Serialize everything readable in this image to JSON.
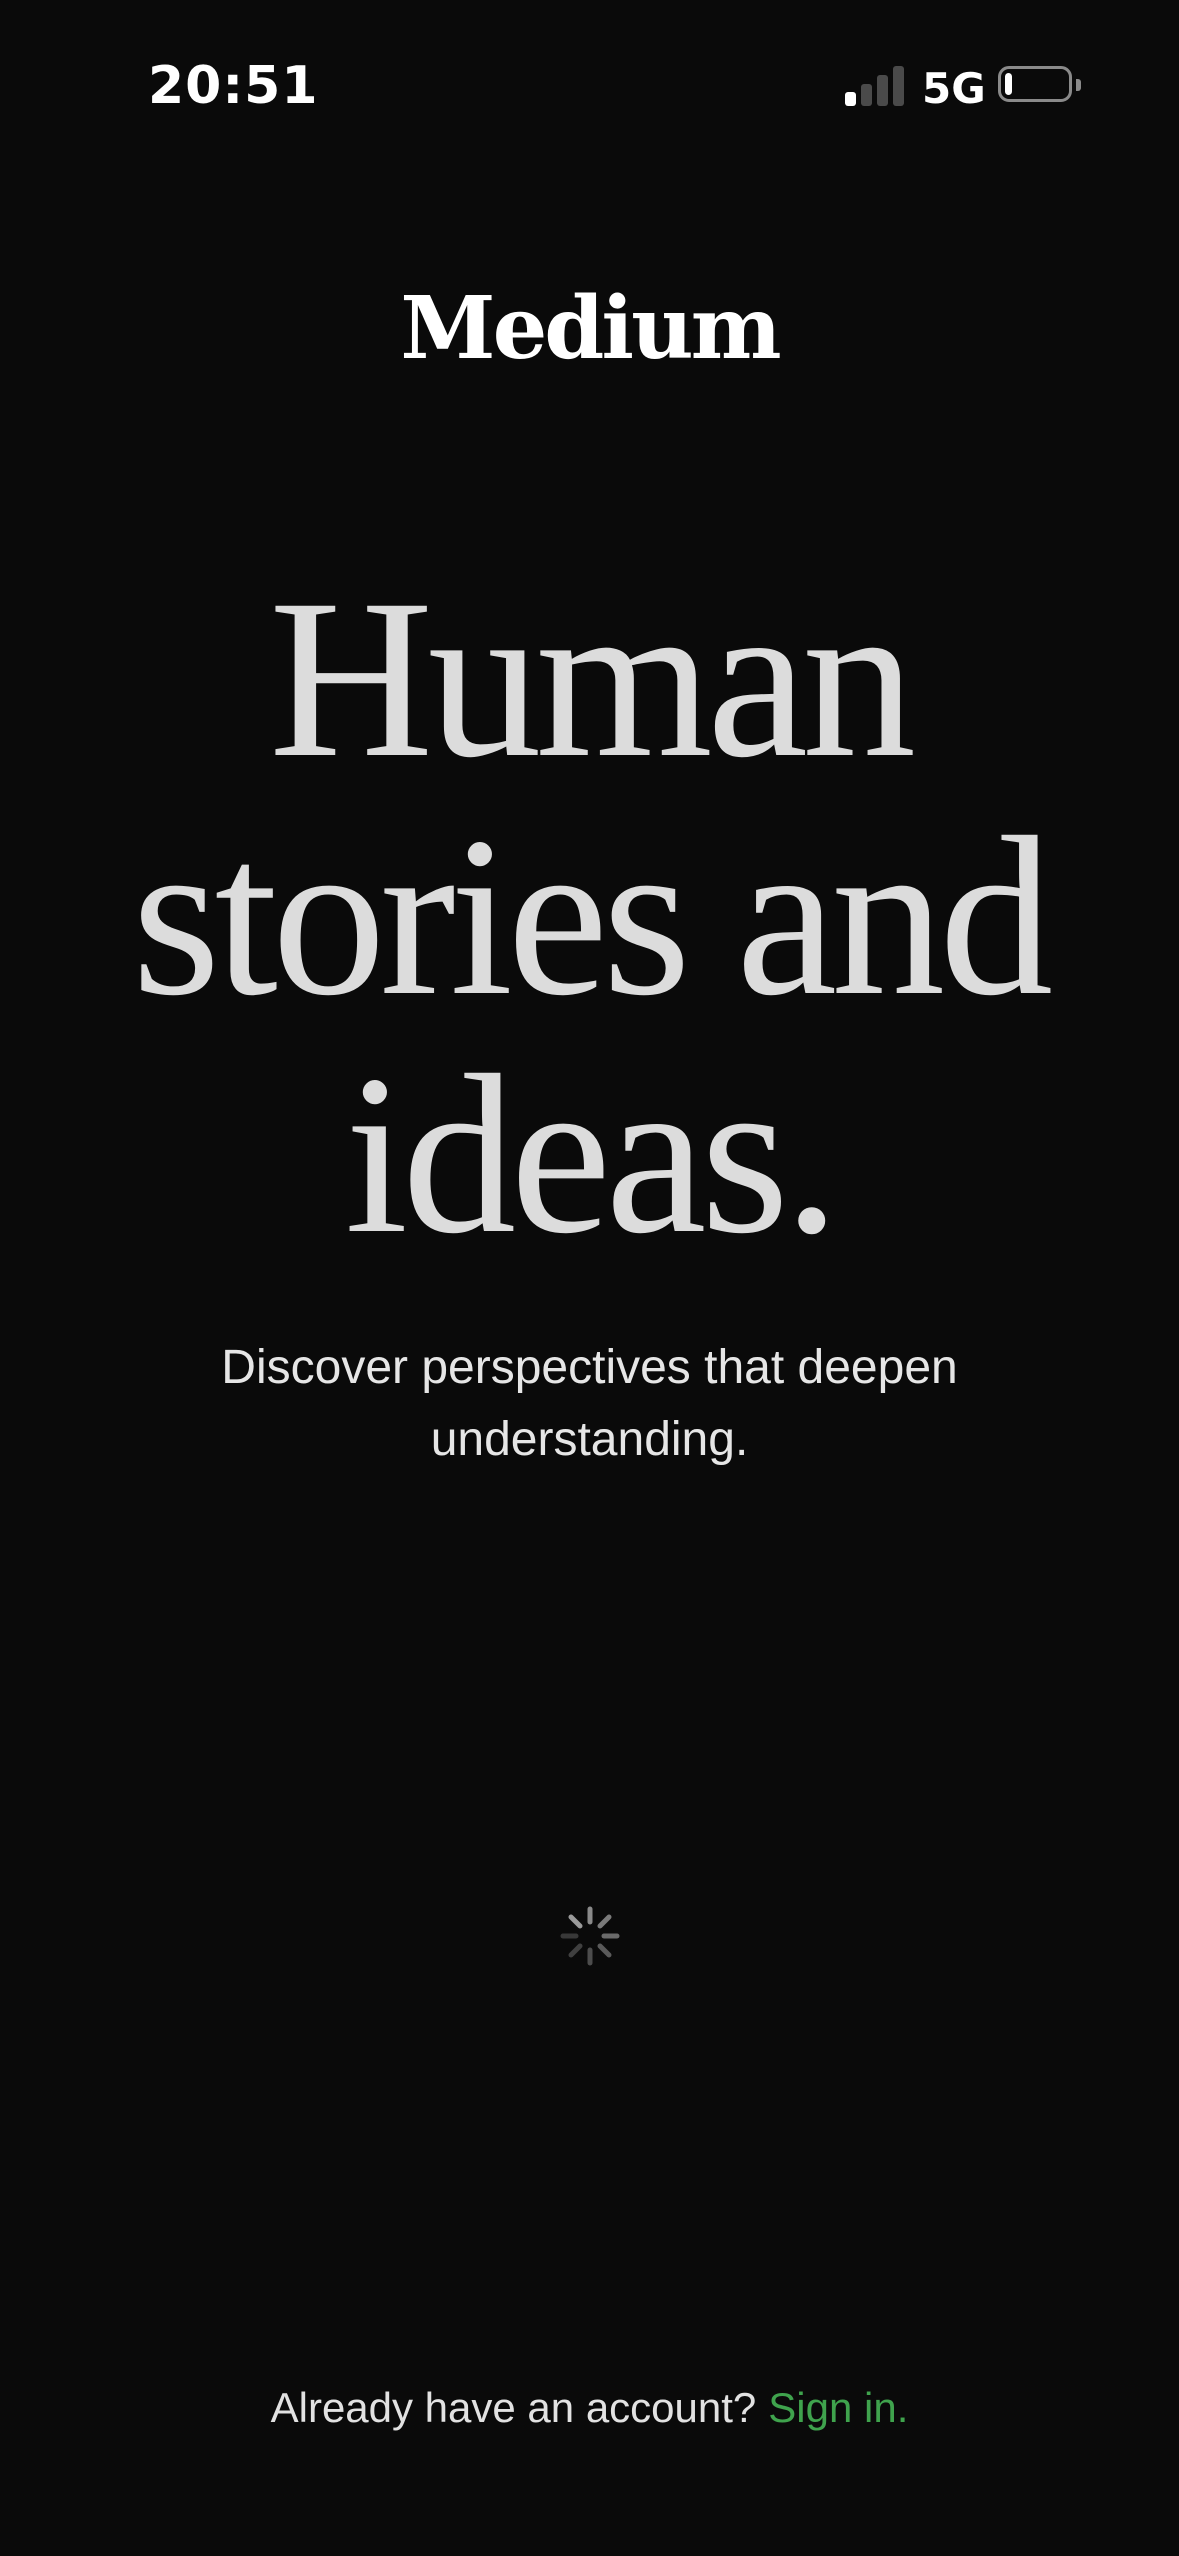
{
  "status_bar": {
    "time": "20:51",
    "network": "5G",
    "signal_bars": 1,
    "signal_bars_total": 4,
    "battery_level": 0.12
  },
  "logo": {
    "text": "Medium"
  },
  "hero": {
    "headline_line1": "Human",
    "headline_line2": "stories and",
    "headline_line3": "ideas.",
    "subtitle_line1": "Discover perspectives that deepen",
    "subtitle_line2": "understanding."
  },
  "loading": {
    "icon": "loading-spinner-icon"
  },
  "footer": {
    "prompt": "Already have an account?",
    "sign_in": "Sign in."
  },
  "colors": {
    "background": "#0a0a0a",
    "headline": "#dcdcdc",
    "accent": "#3fa34d"
  }
}
